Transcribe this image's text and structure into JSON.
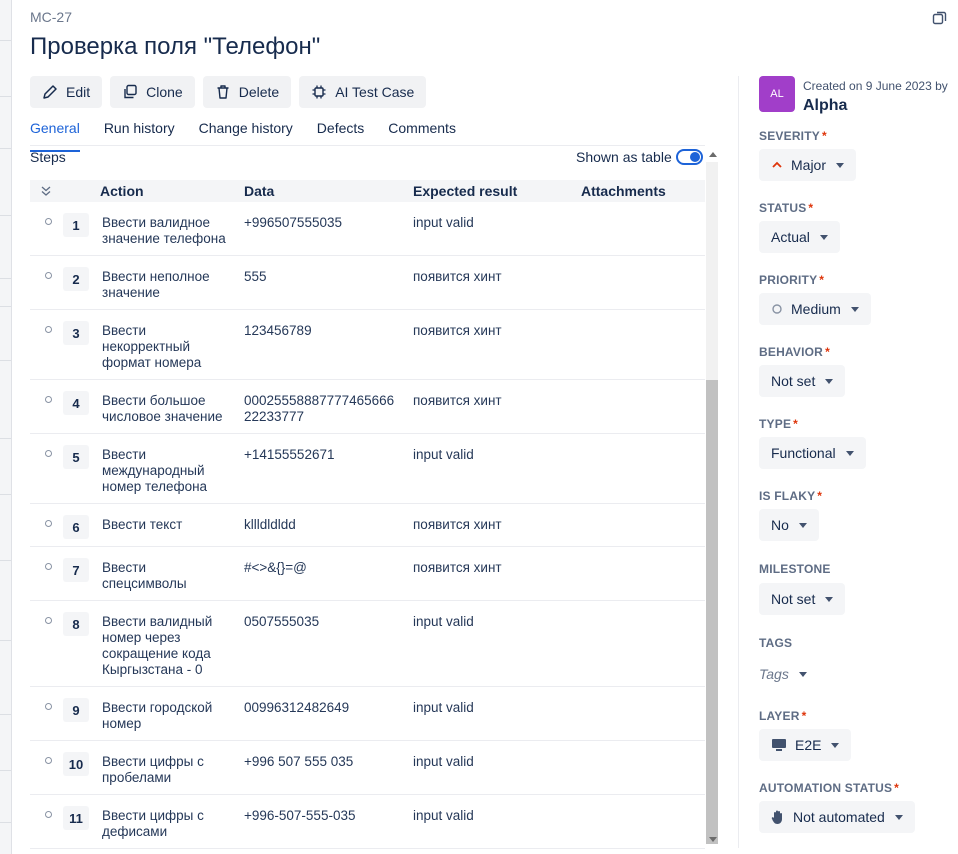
{
  "case": {
    "id": "MC-27",
    "title": "Проверка поля \"Телефон\""
  },
  "toolbar": {
    "edit": "Edit",
    "clone": "Clone",
    "delete": "Delete",
    "ai": "AI Test Case"
  },
  "tabs": [
    {
      "label": "General",
      "active": true
    },
    {
      "label": "Run history"
    },
    {
      "label": "Change history"
    },
    {
      "label": "Defects"
    },
    {
      "label": "Comments"
    }
  ],
  "steps": {
    "label": "Steps",
    "shown_as": "Shown as table",
    "headers": {
      "action": "Action",
      "data": "Data",
      "expected": "Expected result",
      "attachments": "Attachments"
    },
    "rows": [
      {
        "num": "1",
        "action": "Ввести валидное значение телефона",
        "data": "+996507555035",
        "expected": "input valid"
      },
      {
        "num": "2",
        "action": "Ввести неполное значение",
        "data": "555",
        "expected": "появится хинт"
      },
      {
        "num": "3",
        "action": "Ввести некорректный формат номера",
        "data": "123456789",
        "expected": "появится хинт"
      },
      {
        "num": "4",
        "action": "Ввести большое числовое значение",
        "data": "0002555888777746566622233777",
        "expected": "появится хинт"
      },
      {
        "num": "5",
        "action": "Ввести международный номер телефона",
        "data": "+14155552671",
        "expected": "input valid"
      },
      {
        "num": "6",
        "action": "Ввести текст",
        "data": "kllldldldd",
        "expected": "появится хинт"
      },
      {
        "num": "7",
        "action": "Ввести спецсимволы",
        "data": "#<>&{}=@",
        "expected": "появится хинт"
      },
      {
        "num": "8",
        "action": "Ввести валидный номер через сокращение кода Кыргызстана - 0",
        "data": "0507555035",
        "expected": "input valid"
      },
      {
        "num": "9",
        "action": "Ввести городской номер",
        "data": "00996312482649",
        "expected": "input valid"
      },
      {
        "num": "10",
        "action": "Ввести цифры с пробелами",
        "data": "+996 507 555 035",
        "expected": "input valid"
      },
      {
        "num": "11",
        "action": "Ввести цифры с дефисами",
        "data": "+996-507-555-035",
        "expected": "input valid"
      }
    ]
  },
  "sidebar": {
    "avatar": "AL",
    "created": "Created on 9 June 2023 by",
    "creator": "Alpha",
    "fields": {
      "severity": {
        "label": "SEVERITY",
        "value": "Major"
      },
      "status": {
        "label": "STATUS",
        "value": "Actual"
      },
      "priority": {
        "label": "PRIORITY",
        "value": "Medium"
      },
      "behavior": {
        "label": "BEHAVIOR",
        "value": "Not set"
      },
      "type": {
        "label": "TYPE",
        "value": "Functional"
      },
      "is_flaky": {
        "label": "IS FLAKY",
        "value": "No"
      },
      "milestone": {
        "label": "MILESTONE",
        "value": "Not set"
      },
      "tags": {
        "label": "TAGS",
        "value": "Tags"
      },
      "layer": {
        "label": "LAYER",
        "value": "E2E"
      },
      "automation_status": {
        "label": "AUTOMATION STATUS",
        "value": "Not automated"
      }
    },
    "required_mark": "*"
  },
  "colors": {
    "accent": "#1d63d8",
    "required": "#de350b",
    "avatar": "#a13ec9",
    "severity_major": "#de350b"
  }
}
